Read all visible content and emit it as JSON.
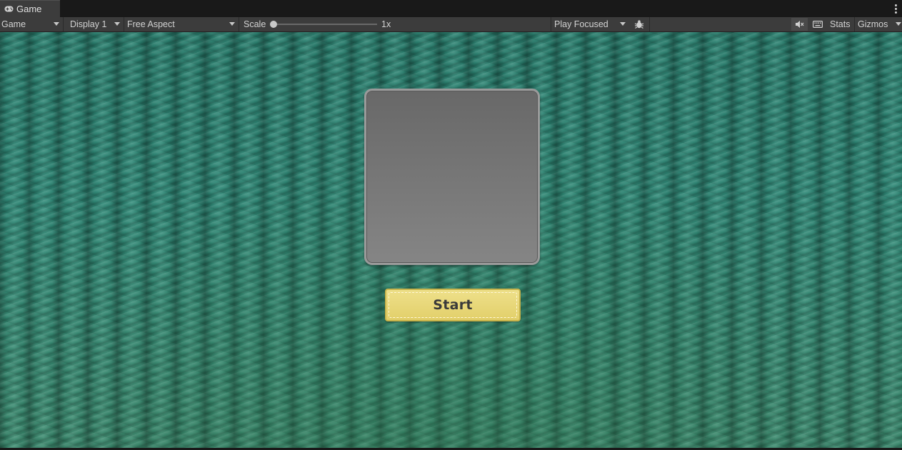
{
  "tabs": [
    {
      "label": "Game",
      "icon": "gamepad-icon"
    }
  ],
  "toolbar": {
    "view_dropdown": "Game",
    "display_dropdown": "Display 1",
    "aspect_dropdown": "Free Aspect",
    "scale_label": "Scale",
    "scale_value": "1x",
    "scale_fraction": 0.0,
    "play_mode_dropdown": "Play Focused",
    "stats_label": "Stats",
    "gizmos_label": "Gizmos"
  },
  "game_view": {
    "start_button_label": "Start"
  },
  "colors": {
    "editor_bg": "#191919",
    "toolbar_bg": "#3c3c3c",
    "knit_green": "#2c8878",
    "panel_gray": "#777777",
    "button_yellow": "#e8d678"
  }
}
